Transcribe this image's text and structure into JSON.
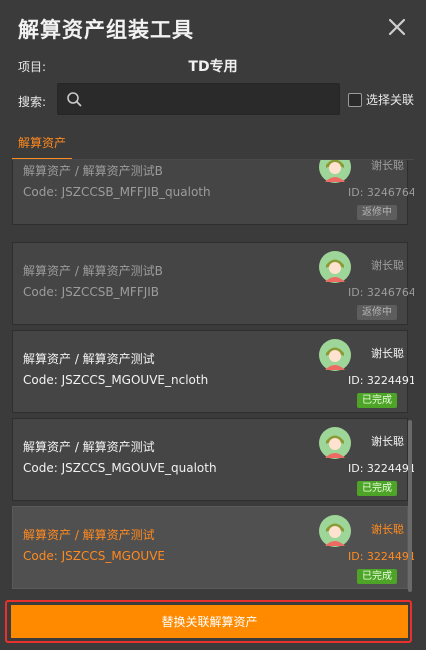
{
  "window": {
    "title": "解算资产组装工具"
  },
  "project": {
    "label": "项目:",
    "value": "TD专用"
  },
  "search": {
    "label": "搜索:",
    "placeholder": "",
    "value": ""
  },
  "filter": {
    "checkbox_label": "选择关联",
    "checked": false
  },
  "tabs": [
    {
      "label": "解算资产",
      "active": true
    }
  ],
  "assets": [
    {
      "path": "解算资产 / 解算资产测试B",
      "code": "Code: JSZCCSB_MFFJIB_qualoth",
      "user": "谢长聪",
      "id": "ID: 3246764",
      "status": "返修中",
      "style": "dim"
    },
    {
      "path": "解算资产 / 解算资产测试B",
      "code": "Code: JSZCCSB_MFFJIB",
      "user": "谢长聪",
      "id": "ID: 3246764",
      "status": "返修中",
      "style": "dim"
    },
    {
      "path": "解算资产 / 解算资产测试",
      "code": "Code: JSZCCS_MGOUVE_ncloth",
      "user": "谢长聪",
      "id": "ID: 3224491",
      "status": "已完成",
      "style": "normal"
    },
    {
      "path": "解算资产 / 解算资产测试",
      "code": "Code: JSZCCS_MGOUVE_qualoth",
      "user": "谢长聪",
      "id": "ID: 3224491",
      "status": "已完成",
      "style": "normal"
    },
    {
      "path": "解算资产 / 解算资产测试",
      "code": "Code: JSZCCS_MGOUVE",
      "user": "谢长聪",
      "id": "ID: 3224491",
      "status": "已完成",
      "style": "selected"
    }
  ],
  "footer": {
    "button_label": "替换关联解算资产"
  },
  "colors": {
    "accent": "#ff8a1f",
    "done": "#4ea427",
    "fix": "#5d5d5d",
    "highlight_frame": "#e8312c"
  },
  "icons": {
    "close": "close-icon",
    "search": "search-icon",
    "avatar": "avatar-icon"
  }
}
